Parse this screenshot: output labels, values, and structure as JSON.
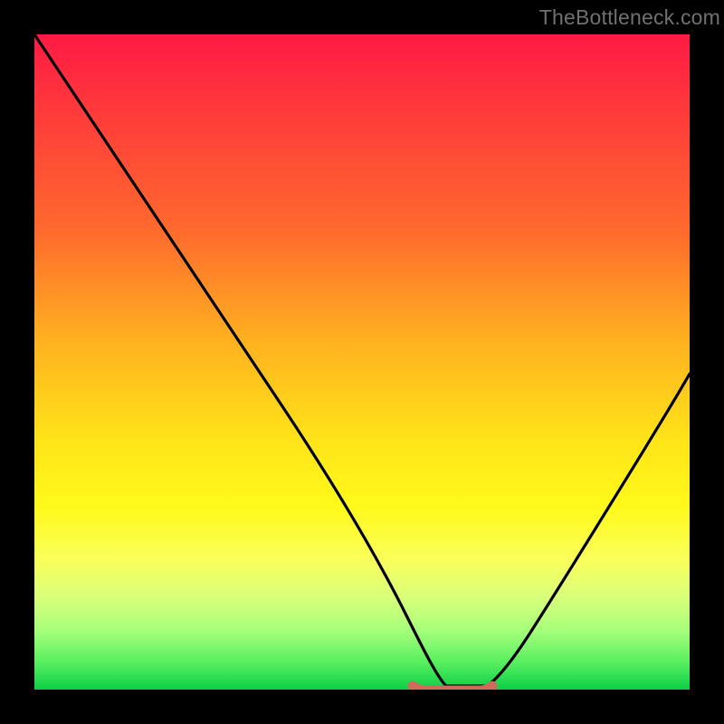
{
  "watermark": "TheBottleneck.com",
  "colors": {
    "frame": "#000000",
    "curve": "#000000",
    "flat_segment": "#cf6a5d",
    "gradient_top": "#ff1a44",
    "gradient_bottom": "#0ccf46"
  },
  "chart_data": {
    "type": "line",
    "title": "",
    "xlabel": "",
    "ylabel": "",
    "xlim": [
      0,
      100
    ],
    "ylim": [
      0,
      100
    ],
    "annotations": [],
    "series": [
      {
        "name": "bottleneck-curve",
        "x": [
          0,
          5,
          10,
          15,
          20,
          25,
          30,
          35,
          40,
          45,
          50,
          55,
          58,
          60,
          63,
          67,
          70,
          75,
          80,
          85,
          90,
          95,
          100
        ],
        "y": [
          100,
          92,
          84,
          76,
          68,
          60,
          51,
          42,
          33,
          24,
          16,
          8,
          3,
          1,
          0,
          0,
          1,
          6,
          14,
          23,
          33,
          43,
          54
        ]
      },
      {
        "name": "flat-optimum-segment",
        "x": [
          58,
          70
        ],
        "y": [
          0.5,
          0.5
        ]
      }
    ],
    "grid": false,
    "legend": false
  }
}
